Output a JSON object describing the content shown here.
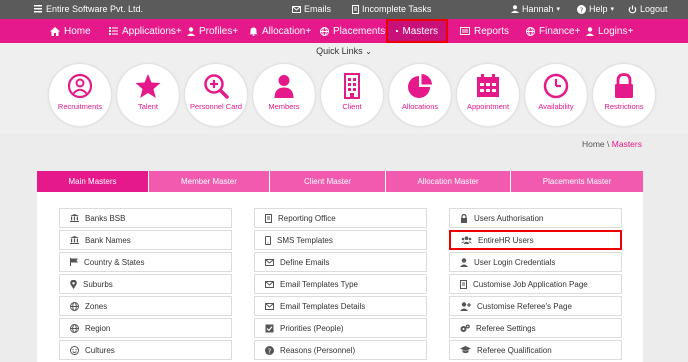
{
  "topbar": {
    "brand": "Entire Software Pvt. Ltd.",
    "emails": "Emails",
    "incomplete_tasks": "Incomplete Tasks",
    "user": "Hannah",
    "help": "Help",
    "logout": "Logout"
  },
  "nav": {
    "home": "Home",
    "applications": "Applications+",
    "profiles": "Profiles+",
    "allocation": "Allocation+",
    "placements": "Placements+",
    "masters": "Masters",
    "reports": "Reports",
    "finance": "Finance+",
    "logins": "Logins+"
  },
  "quick_links": {
    "title": "Quick Links",
    "items": [
      "Recruitments",
      "Talent",
      "Personnel Card",
      "Members",
      "Client",
      "Allocations",
      "Appointment",
      "Availability",
      "Restrictions"
    ]
  },
  "breadcrumb": {
    "home": "Home",
    "sep": " \\ ",
    "current": "Masters"
  },
  "tabs": [
    "Main Masters",
    "Member Master",
    "Client Master",
    "Allocation Master",
    "Placements Master"
  ],
  "columns": {
    "col1": [
      "Banks BSB",
      "Bank Names",
      "Country & States",
      "Suburbs",
      "Zones",
      "Region",
      "Cultures"
    ],
    "col2": [
      "Reporting Office",
      "SMS Templates",
      "Define Emails",
      "Email Templates Type",
      "Email Templates Details",
      "Priorities (People)",
      "Reasons (Personnel)"
    ],
    "col3": [
      "Users Authorisation",
      "EntireHR Users",
      "User Login Credentials",
      "Customise Job Application Page",
      "Customise Referee's Page",
      "Referee Settings",
      "Referee Qualification"
    ]
  },
  "colors": {
    "accent": "#e6198a",
    "highlight": "#ee0000",
    "topbar": "#5b5b5b"
  }
}
